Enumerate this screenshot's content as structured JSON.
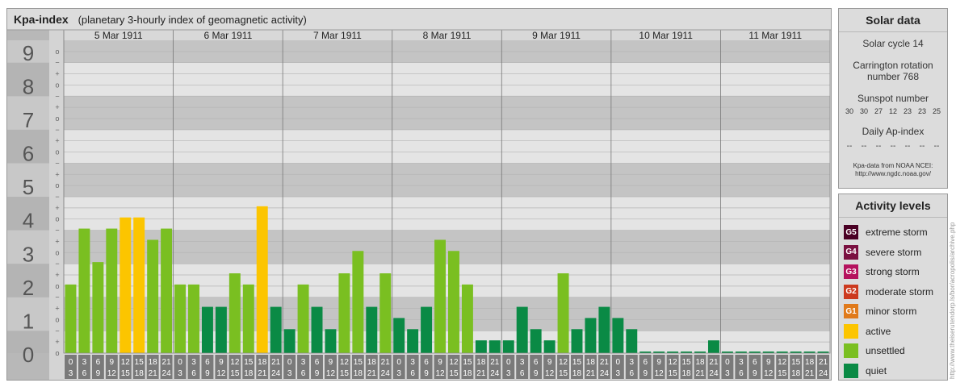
{
  "header": {
    "title": "Kpa-index",
    "subtitle": "(planetary 3-hourly index of geomagnetic activity)"
  },
  "chart_data": {
    "type": "bar",
    "title": "Kpa-index",
    "subtitle": "(planetary 3-hourly index of geomagnetic activity)",
    "ylim": [
      0,
      9
    ],
    "y_ticks": [
      "0",
      "1",
      "2",
      "3",
      "4",
      "5",
      "6",
      "7",
      "8",
      "9"
    ],
    "y_minor_ticks": [
      "o",
      "+",
      "−"
    ],
    "days": [
      "5 Mar 1911",
      "6 Mar 1911",
      "7 Mar 1911",
      "8 Mar 1911",
      "9 Mar 1911",
      "10 Mar 1911",
      "11 Mar 1911"
    ],
    "interval_start": [
      "0",
      "3",
      "6",
      "9",
      "12",
      "15",
      "18",
      "21"
    ],
    "interval_end": [
      "3",
      "6",
      "9",
      "12",
      "15",
      "18",
      "21",
      "24"
    ],
    "values": [
      [
        2.0,
        3.667,
        2.667,
        3.667,
        4.0,
        4.0,
        3.333,
        3.667
      ],
      [
        2.0,
        2.0,
        1.333,
        1.333,
        2.333,
        2.0,
        4.333,
        1.333
      ],
      [
        0.667,
        2.0,
        1.333,
        0.667,
        2.333,
        3.0,
        1.333,
        2.333
      ],
      [
        1.0,
        0.667,
        1.333,
        3.333,
        3.0,
        2.0,
        0.333,
        0.333
      ],
      [
        0.333,
        1.333,
        0.667,
        0.333,
        2.333,
        0.667,
        1.0,
        1.333
      ],
      [
        1.0,
        0.667,
        0.0,
        0.0,
        0.0,
        0.0,
        0.0,
        0.333
      ],
      [
        0.0,
        0.0,
        0.0,
        0.0,
        0.0,
        0.0,
        0.0,
        0.0
      ]
    ],
    "level_colors": {
      "quiet": "#0a8a45",
      "unsettled": "#7abf21",
      "active": "#fcc500",
      "minor_storm": "#e07a1a",
      "moderate_storm": "#cc3a1f",
      "strong_storm": "#b5125e",
      "severe_storm": "#7a1040",
      "extreme_storm": "#4a0024"
    },
    "grid": true,
    "legend_position": "right"
  },
  "solar_data": {
    "title": "Solar data",
    "solar_cycle": "Solar cycle 14",
    "carrington_line1": "Carrington rotation",
    "carrington_line2": "number 768",
    "sunspot_label": "Sunspot number",
    "sunspot_values": [
      "30",
      "30",
      "27",
      "12",
      "23",
      "23",
      "25"
    ],
    "ap_label": "Daily Ap-index",
    "ap_values": [
      "--",
      "--",
      "--",
      "--",
      "--",
      "--",
      "--"
    ],
    "source_line1": "Kpa-data from NOAA NCEI:",
    "source_line2": "http://www.ngdc.noaa.gov/"
  },
  "activity_levels": {
    "title": "Activity levels",
    "items": [
      {
        "badge": "G5",
        "label": "extreme storm",
        "color": "#4a0024"
      },
      {
        "badge": "G4",
        "label": "severe storm",
        "color": "#7a1040"
      },
      {
        "badge": "G3",
        "label": "strong storm",
        "color": "#b5125e"
      },
      {
        "badge": "G2",
        "label": "moderate storm",
        "color": "#cc3a1f"
      },
      {
        "badge": "G1",
        "label": "minor storm",
        "color": "#e07a1a"
      },
      {
        "badge": "",
        "label": "active",
        "color": "#fcc500"
      },
      {
        "badge": "",
        "label": "unsettled",
        "color": "#7abf21"
      },
      {
        "badge": "",
        "label": "quiet",
        "color": "#0a8a45"
      }
    ]
  },
  "credit": "http://www.theiserutendorp.ls/bor/acropolis/archive.php"
}
